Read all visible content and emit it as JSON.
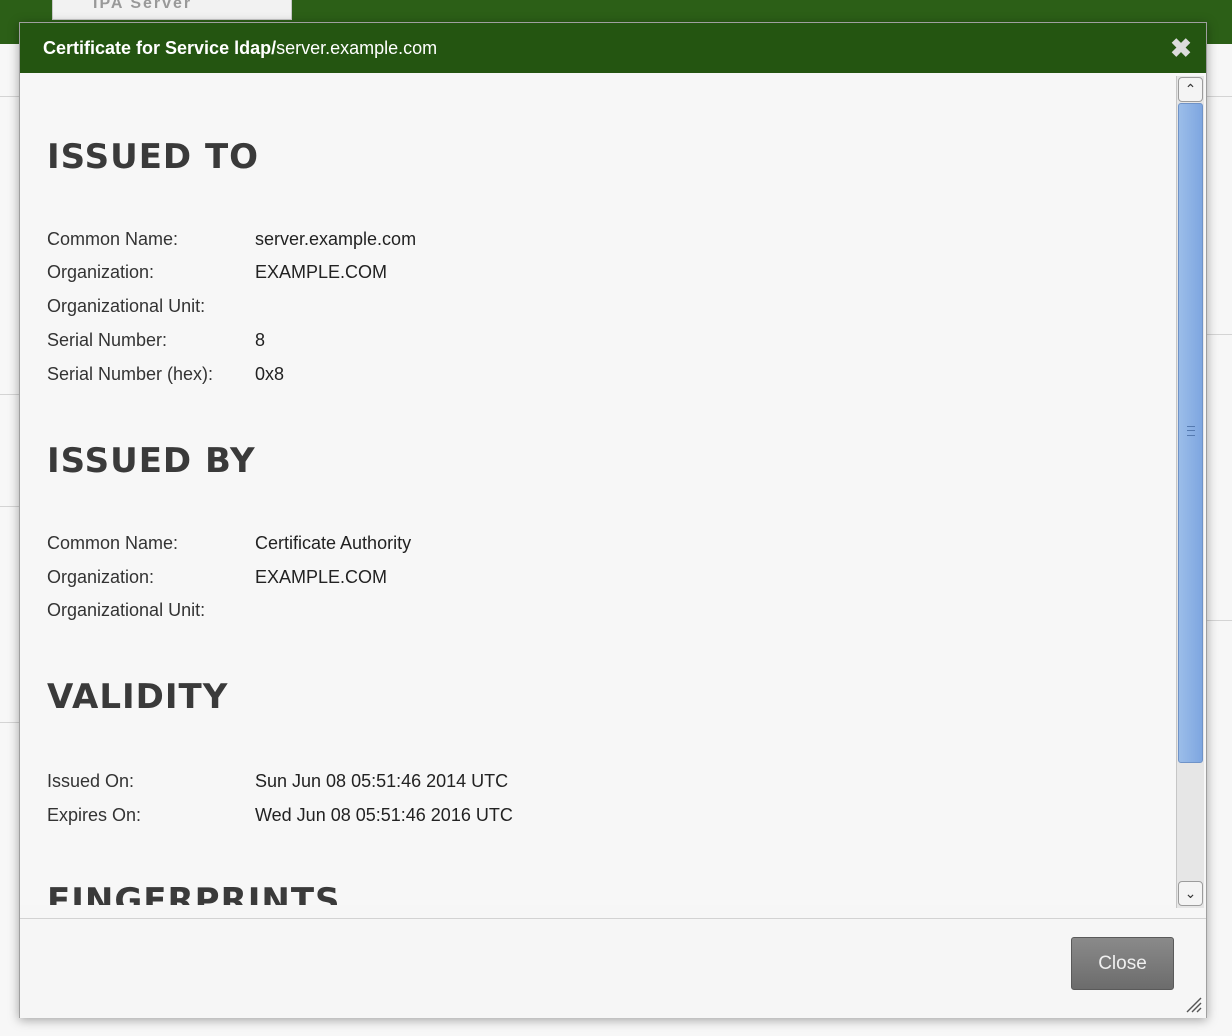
{
  "background": {
    "tab_label": "IPA Server"
  },
  "dialog": {
    "title_bold": "Certificate for Service ldap/",
    "title_rest": "server.example.com",
    "close_icon": "close-x-icon",
    "close_button_label": "Close",
    "header_color": "#245511"
  },
  "issued_to": {
    "heading": "ISSUED TO",
    "rows": [
      {
        "label": "Common Name:",
        "value": "server.example.com"
      },
      {
        "label": "Organization:",
        "value": "EXAMPLE.COM"
      },
      {
        "label": "Organizational Unit:",
        "value": ""
      },
      {
        "label": "Serial Number:",
        "value": "8"
      },
      {
        "label": "Serial Number (hex):",
        "value": "0x8"
      }
    ]
  },
  "issued_by": {
    "heading": "ISSUED BY",
    "rows": [
      {
        "label": "Common Name:",
        "value": "Certificate Authority"
      },
      {
        "label": "Organization:",
        "value": "EXAMPLE.COM"
      },
      {
        "label": "Organizational Unit:",
        "value": ""
      }
    ]
  },
  "validity": {
    "heading": "VALIDITY",
    "rows": [
      {
        "label": "Issued On:",
        "value": "Sun Jun 08 05:51:46 2014 UTC"
      },
      {
        "label": "Expires On:",
        "value": "Wed Jun 08 05:51:46 2016 UTC"
      }
    ]
  },
  "fingerprints": {
    "heading": "FINGERPRINTS"
  },
  "scrollbar": {
    "up_icon": "chevron-up-icon",
    "down_icon": "chevron-down-icon"
  }
}
